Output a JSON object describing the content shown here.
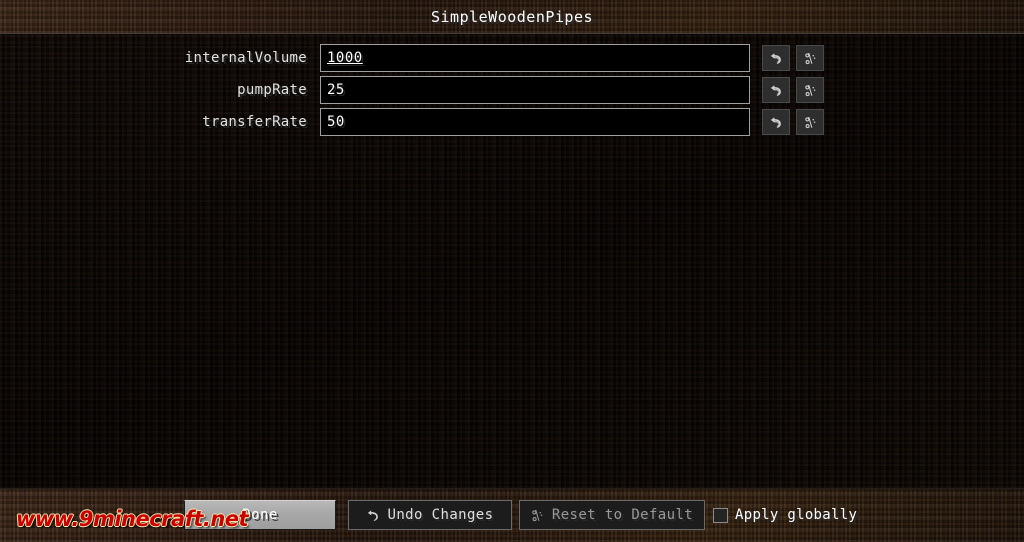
{
  "window": {
    "title": "SimpleWoodenPipes"
  },
  "options": [
    {
      "label": "internalVolume",
      "value": "1000",
      "modified": true,
      "undo_icon": "undo-arrow-icon",
      "reset_icon": "reset-key-icon"
    },
    {
      "label": "pumpRate",
      "value": "25",
      "modified": false,
      "undo_icon": "undo-arrow-icon",
      "reset_icon": "reset-key-icon"
    },
    {
      "label": "transferRate",
      "value": "50",
      "modified": false,
      "undo_icon": "undo-arrow-icon",
      "reset_icon": "reset-key-icon"
    }
  ],
  "footer": {
    "done_label": "Done",
    "undo_changes_label": "Undo Changes",
    "undo_changes_icon": "undo-arrow-icon",
    "reset_default_label": "Reset to Default",
    "reset_default_icon": "reset-key-icon",
    "apply_globally_label": "Apply globally",
    "apply_globally_checked": false
  },
  "watermark": {
    "text": "www.9minecraft.net"
  },
  "colors": {
    "header_dirt": "#2a1a10",
    "body_dirt": "#0b0604",
    "input_border": "#a0a0a0",
    "input_fill": "#000000",
    "text": "#ffffff",
    "disabled_text": "#9a9a9a",
    "primary_button": "#a8a8a8",
    "watermark_red": "#cc0000",
    "watermark_outline": "#f2e4a0"
  }
}
